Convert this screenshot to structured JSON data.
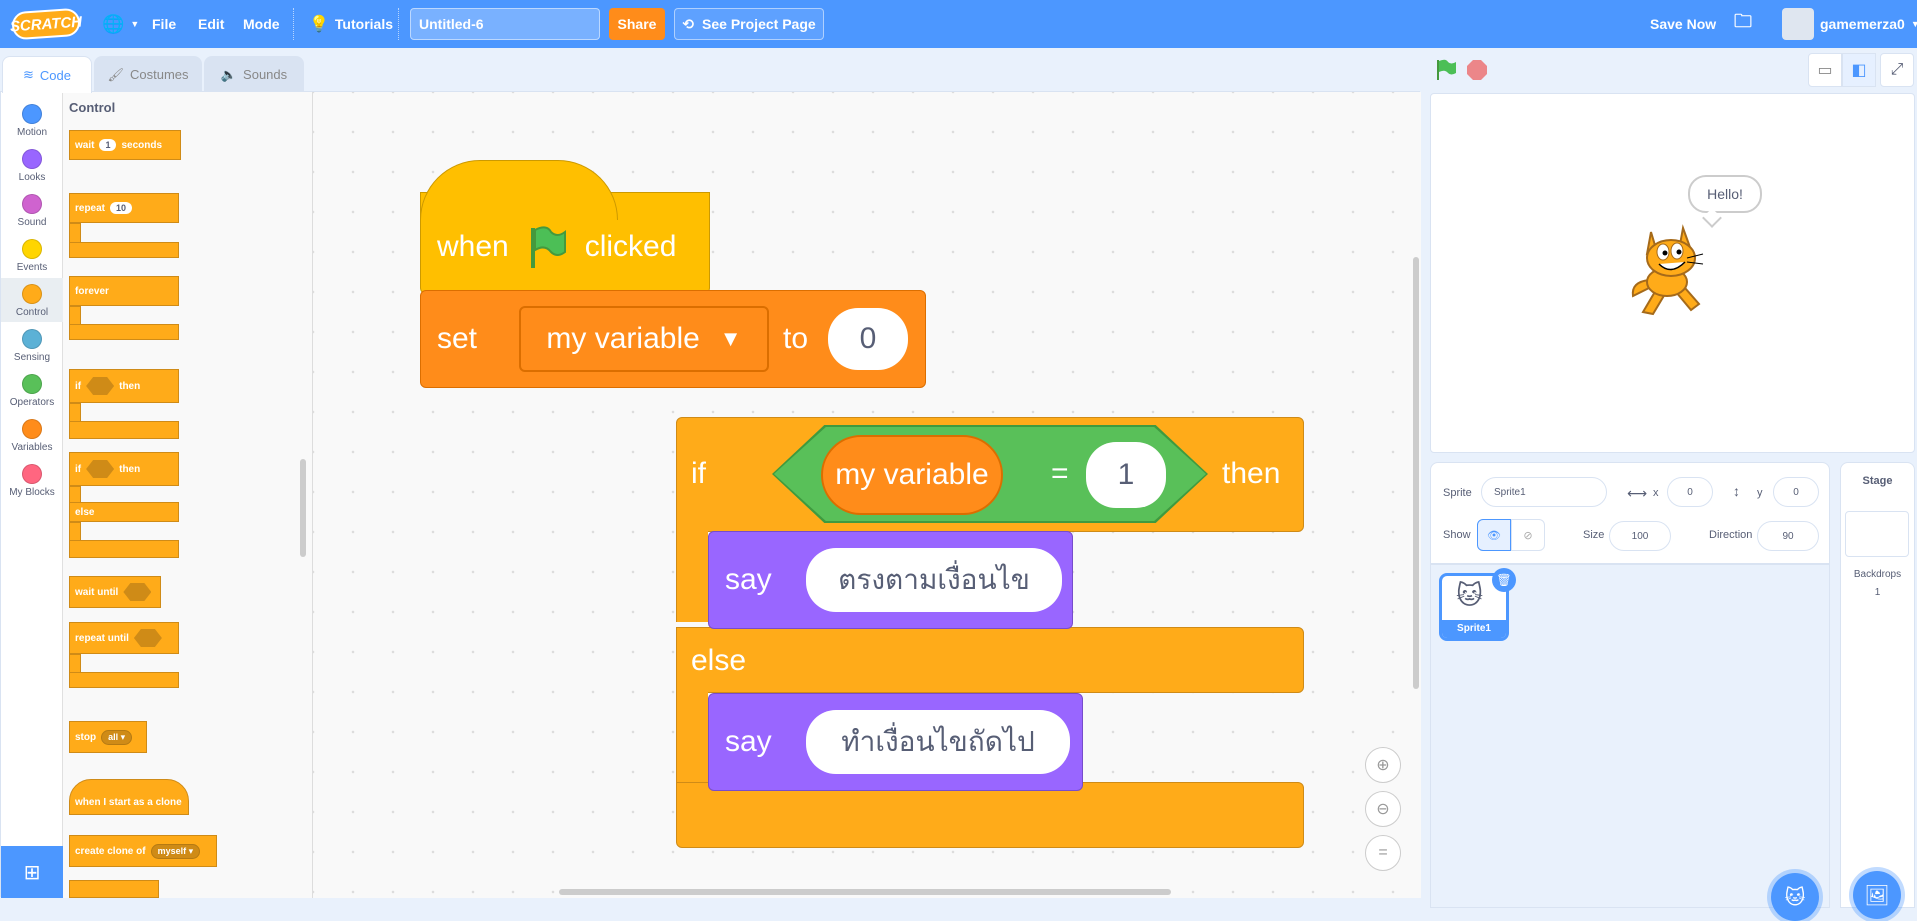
{
  "menu": {
    "logo": "SCRATCH",
    "file": "File",
    "edit": "Edit",
    "mode": "Mode",
    "tutorials": "Tutorials",
    "project_title": "Untitled-6",
    "share": "Share",
    "see_project_page": "See Project Page",
    "save_now": "Save Now",
    "username": "gamemerza0"
  },
  "tabs": {
    "code": "Code",
    "costumes": "Costumes",
    "sounds": "Sounds"
  },
  "categories": [
    {
      "label": "Motion",
      "color": "#4c97ff"
    },
    {
      "label": "Looks",
      "color": "#9966ff"
    },
    {
      "label": "Sound",
      "color": "#cf63cf"
    },
    {
      "label": "Events",
      "color": "#ffd500"
    },
    {
      "label": "Control",
      "color": "#ffab19"
    },
    {
      "label": "Sensing",
      "color": "#5cb1d6"
    },
    {
      "label": "Operators",
      "color": "#59c059"
    },
    {
      "label": "Variables",
      "color": "#ff8c1a"
    },
    {
      "label": "My Blocks",
      "color": "#ff6680"
    }
  ],
  "palette": {
    "heading": "Control",
    "wait": "wait",
    "wait_val": "1",
    "seconds": "seconds",
    "repeat": "repeat",
    "repeat_val": "10",
    "forever": "forever",
    "if": "if",
    "then": "then",
    "else": "else",
    "wait_until": "wait until",
    "repeat_until": "repeat until",
    "stop": "stop",
    "stop_val": "all",
    "when_clone": "when I start as a clone",
    "create_clone": "create clone of",
    "clone_val": "myself"
  },
  "script": {
    "when": "when",
    "clicked": "clicked",
    "set": "set",
    "variable": "my variable",
    "to": "to",
    "set_val": "0",
    "if": "if",
    "then": "then",
    "eq": "=",
    "cmp_val": "1",
    "say": "say",
    "say1": "ตรงตามเงื่อนไข",
    "else": "else",
    "say2": "ทำเงื่อนไขถัดไป"
  },
  "stage": {
    "bubble": "Hello!"
  },
  "sprite_info": {
    "sprite_label": "Sprite",
    "sprite_name": "Sprite1",
    "x_label": "x",
    "x_val": "0",
    "y_label": "y",
    "y_val": "0",
    "show_label": "Show",
    "size_label": "Size",
    "size_val": "100",
    "direction_label": "Direction",
    "direction_val": "90"
  },
  "sprites": [
    {
      "name": "Sprite1"
    }
  ],
  "stage_panel": {
    "title": "Stage",
    "backdrops_label": "Backdrops",
    "backdrops_count": "1"
  },
  "colors": {
    "accent": "#4c97ff",
    "control": "#ffab19",
    "events": "#ffbf00",
    "variables": "#ff8c1a",
    "looks": "#9966ff",
    "operators": "#59c059"
  }
}
